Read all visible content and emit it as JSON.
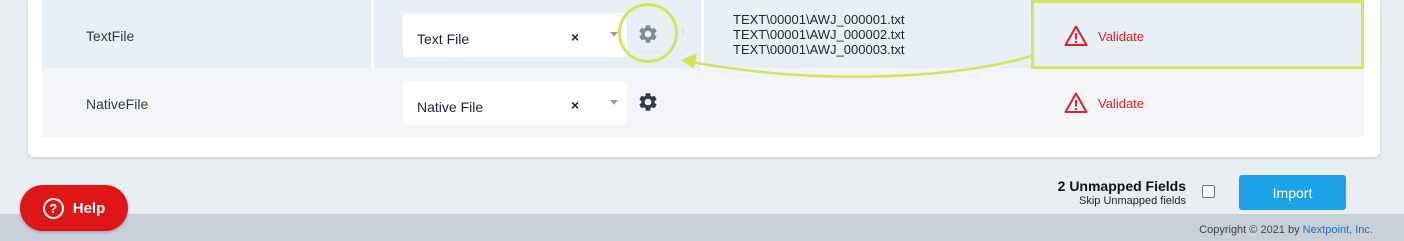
{
  "rows": [
    {
      "field": "TextFile",
      "selected": "Text File",
      "clear_symbol": "×",
      "files": [
        "TEXT\\00001\\AWJ_000001.txt",
        "TEXT\\00001\\AWJ_000002.txt",
        "TEXT\\00001\\AWJ_000003.txt"
      ],
      "validate_label": "Validate"
    },
    {
      "field": "NativeFile",
      "selected": "Native File",
      "clear_symbol": "×",
      "validate_label": "Validate"
    }
  ],
  "icons": {
    "settings": "gear-icon",
    "warning": "warning-triangle-icon",
    "help": "question-circle-icon"
  },
  "footer": {
    "unmapped_count": "2 Unmapped Fields",
    "skip_label": "Skip Unmapped fields",
    "import_label": "Import",
    "help_label": "Help",
    "help_icon_glyph": "?",
    "copyright_text": "Copyright © 2021 by",
    "copyright_link": "Nextpoint, Inc."
  },
  "colors": {
    "highlight": "#d3e55a",
    "danger": "#e02020",
    "primary": "#1aa3e8",
    "help": "#e01515"
  }
}
